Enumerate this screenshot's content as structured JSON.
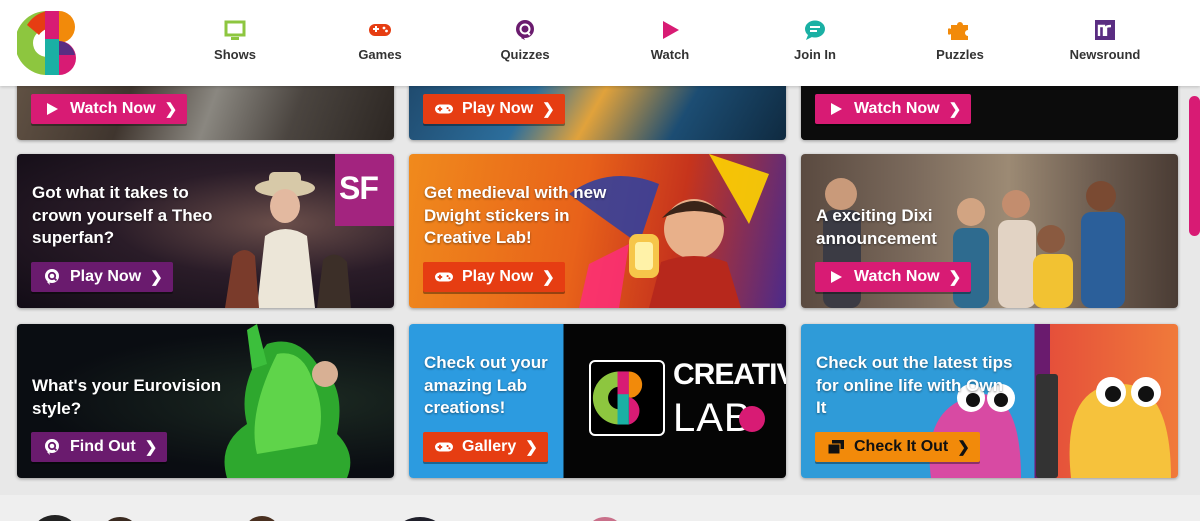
{
  "nav": [
    {
      "label": "Shows",
      "icon": "tv-icon",
      "color": "#8dc63f"
    },
    {
      "label": "Games",
      "icon": "gamepad-icon",
      "color": "#e63d12"
    },
    {
      "label": "Quizzes",
      "icon": "quiz-icon",
      "color": "#6a1b6e"
    },
    {
      "label": "Watch",
      "icon": "play-icon",
      "color": "#d81b74"
    },
    {
      "label": "Join In",
      "icon": "chat-icon",
      "color": "#1ab0a4"
    },
    {
      "label": "Puzzles",
      "icon": "puzzle-icon",
      "color": "#f28a0a"
    },
    {
      "label": "Newsround",
      "icon": "newsround-icon",
      "color": "#5a2d82"
    }
  ],
  "cards": [
    {
      "title": "",
      "cta": "Watch Now",
      "cta_style": "pink",
      "cta_icon": "play-icon"
    },
    {
      "title": "",
      "cta": "Play Now",
      "cta_style": "red",
      "cta_icon": "gamepad-icon"
    },
    {
      "title": "",
      "cta": "Watch Now",
      "cta_style": "pink",
      "cta_icon": "play-icon"
    },
    {
      "title": "Got what it takes to crown yourself a Theo superfan?",
      "cta": "Play Now",
      "cta_style": "purple",
      "cta_icon": "quiz-icon",
      "badge": "SF"
    },
    {
      "title": "Get medieval with new Dwight stickers in Creative Lab!",
      "cta": "Play Now",
      "cta_style": "red",
      "cta_icon": "gamepad-icon"
    },
    {
      "title": "A exciting Dixi announcement",
      "cta": "Watch Now",
      "cta_style": "pink",
      "cta_icon": "play-icon"
    },
    {
      "title": "What's your Eurovision style?",
      "cta": "Find Out",
      "cta_style": "purple",
      "cta_icon": "quiz-icon"
    },
    {
      "title": "Check out your amazing Lab creations!",
      "cta": "Gallery",
      "cta_style": "red",
      "cta_icon": "gamepad-icon",
      "lab_line1": "CREATIVE",
      "lab_line2": "LAB"
    },
    {
      "title": "Check out the latest tips for online life with Own It",
      "cta": "Check It Out",
      "cta_style": "orange",
      "cta_icon": "cards-icon"
    }
  ],
  "colors": {
    "pink": "#d81b74",
    "red": "#e63d12",
    "purple": "#6a1b6e",
    "orange": "#f28a0a"
  }
}
